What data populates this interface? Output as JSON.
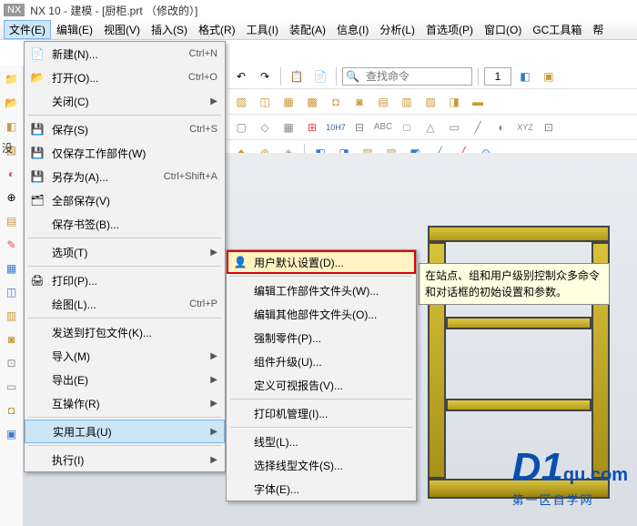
{
  "title": {
    "app": "NX 10",
    "mode": "建模",
    "file": "厨柜.prt",
    "status": "修改的"
  },
  "menubar": [
    "文件(E)",
    "编辑(E)",
    "视图(V)",
    "插入(S)",
    "格式(R)",
    "工具(I)",
    "装配(A)",
    "信息(I)",
    "分析(L)",
    "首选项(P)",
    "窗口(O)",
    "GC工具箱",
    "帮"
  ],
  "cmd_finder_placeholder": "查找命令",
  "no_selection": "没",
  "page_value": "1",
  "file_menu": {
    "items": [
      {
        "label": "新建(N)...",
        "shortcut": "Ctrl+N",
        "icon": "new"
      },
      {
        "label": "打开(O)...",
        "shortcut": "Ctrl+O",
        "icon": "open"
      },
      {
        "label": "关闭(C)",
        "sub": true
      },
      "sep",
      {
        "label": "保存(S)",
        "shortcut": "Ctrl+S",
        "icon": "save"
      },
      {
        "label": "仅保存工作部件(W)",
        "icon": "save-work"
      },
      {
        "label": "另存为(A)...",
        "shortcut": "Ctrl+Shift+A",
        "icon": "save-as"
      },
      {
        "label": "全部保存(V)",
        "icon": "save-all"
      },
      {
        "label": "保存书签(B)..."
      },
      "sep",
      {
        "label": "选项(T)",
        "sub": true
      },
      "sep",
      {
        "label": "打印(P)...",
        "icon": "print"
      },
      {
        "label": "绘图(L)...",
        "shortcut": "Ctrl+P"
      },
      "sep",
      {
        "label": "发送到打包文件(K)..."
      },
      {
        "label": "导入(M)",
        "sub": true
      },
      {
        "label": "导出(E)",
        "sub": true
      },
      {
        "label": "互操作(R)",
        "sub": true
      },
      "sep",
      {
        "label": "实用工具(U)",
        "sub": true,
        "hover": true
      },
      "sep",
      {
        "label": "执行(I)",
        "sub": true
      }
    ]
  },
  "submenu": {
    "items": [
      {
        "label": "用户默认设置(D)...",
        "hl": true,
        "icon": "user"
      },
      "sep",
      {
        "label": "编辑工作部件文件头(W)..."
      },
      {
        "label": "编辑其他部件文件头(O)..."
      },
      {
        "label": "强制零件(P)..."
      },
      {
        "label": "组件升级(U)..."
      },
      {
        "label": "定义可视报告(V)..."
      },
      "sep",
      {
        "label": "打印机管理(I)..."
      },
      "sep",
      {
        "label": "线型(L)..."
      },
      {
        "label": "选择线型文件(S)..."
      },
      {
        "label": "字体(E)..."
      }
    ]
  },
  "tooltip": "在站点、组和用户级别控制众多命令和对话框的初始设置和参数。",
  "watermark": {
    "brand": "D1",
    "domain": "qu.com",
    "sub": "第一区自学网"
  }
}
